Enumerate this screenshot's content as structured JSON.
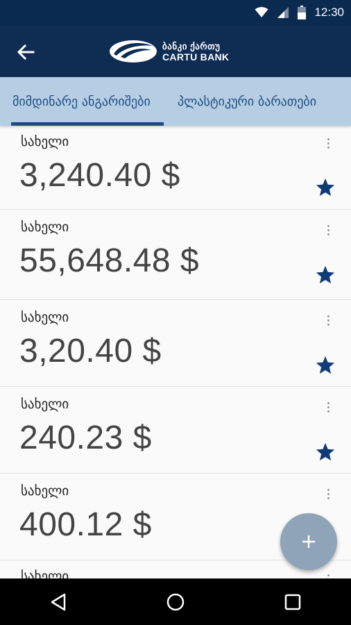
{
  "status_bar": {
    "time": "12:30",
    "icons": [
      "wifi-icon",
      "signal-icon",
      "battery-icon"
    ]
  },
  "header": {
    "back_icon": "arrow-left-icon",
    "logo": {
      "line1": "ბანკი ქართუ",
      "line2": "CARTU BANK"
    }
  },
  "tabs": [
    {
      "label": "მიმდინარე ანგარიშები",
      "active": true
    },
    {
      "label": "პლასტიკური ბარათები",
      "active": false
    }
  ],
  "accounts": [
    {
      "name": "სახელი",
      "amount": "3,240.40 $",
      "favorite": true
    },
    {
      "name": "სახელი",
      "amount": "55,648.48 $",
      "favorite": true
    },
    {
      "name": "სახელი",
      "amount": "3,20.40 $",
      "favorite": true
    },
    {
      "name": "სახელი",
      "amount": "240.23 $",
      "favorite": true
    },
    {
      "name": "სახელი",
      "amount": "400.12 $",
      "favorite": false
    },
    {
      "name": "სახელი",
      "amount": "",
      "favorite": false
    }
  ],
  "fab": {
    "icon": "plus-icon"
  },
  "nav_bar": {
    "icons": [
      "back-triangle-icon",
      "home-circle-icon",
      "recents-square-icon"
    ]
  },
  "colors": {
    "status_bar": "#0b2a4f",
    "app_bar": "#0f2c53",
    "tab_bar": "#b6cee4",
    "tab_text": "#1d4c80",
    "star": "#0f3b78",
    "fab": "#8fa4b8"
  }
}
